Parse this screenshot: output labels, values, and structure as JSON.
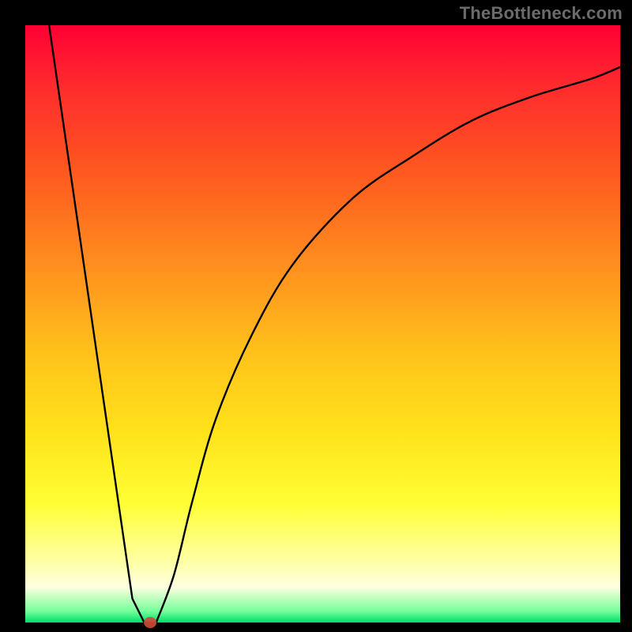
{
  "watermark": "TheBottleneck.com",
  "chart_data": {
    "type": "line",
    "title": "",
    "xlabel": "",
    "ylabel": "",
    "xlim": [
      0,
      100
    ],
    "ylim": [
      0,
      100
    ],
    "grid": false,
    "legend": false,
    "series": [
      {
        "name": "bottleneck-curve",
        "x": [
          4,
          18,
          20,
          22,
          25,
          28,
          32,
          38,
          45,
          55,
          65,
          75,
          85,
          95,
          100
        ],
        "y": [
          100,
          4,
          0,
          0,
          8,
          20,
          34,
          48,
          60,
          71,
          78,
          84,
          88,
          91,
          93
        ]
      }
    ],
    "marker": {
      "x": 21,
      "y": 0,
      "color": "#cc4a3a"
    },
    "gradient_stops": [
      {
        "pct": 0,
        "color": "#ff0033"
      },
      {
        "pct": 25,
        "color": "#ff5a1f"
      },
      {
        "pct": 55,
        "color": "#ffc21a"
      },
      {
        "pct": 80,
        "color": "#ffff33"
      },
      {
        "pct": 94,
        "color": "#ffffe0"
      },
      {
        "pct": 100,
        "color": "#00e06a"
      }
    ]
  }
}
